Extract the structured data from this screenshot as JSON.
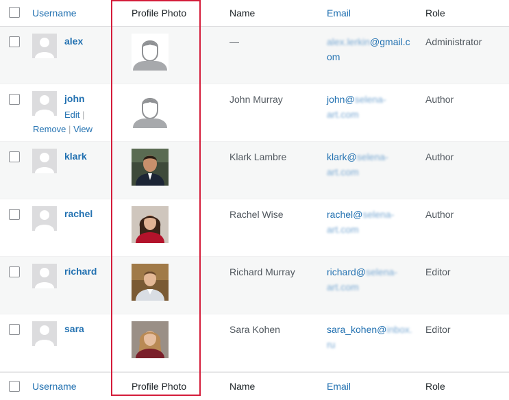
{
  "columns": {
    "username": "Username",
    "profile_photo": "Profile Photo",
    "name": "Name",
    "email": "Email",
    "role": "Role"
  },
  "row_actions": {
    "edit": "Edit",
    "remove": "Remove",
    "view": "View",
    "separator": "|"
  },
  "users": [
    {
      "username": "alex",
      "name": "—",
      "email_visible": "@gmail.c",
      "email_blurred_1": "alex.lerkin",
      "email_line2": "om",
      "email_line2_blurred": "",
      "role": "Administrator",
      "photo": "placeholder"
    },
    {
      "username": "john",
      "name": "John Murray",
      "email_visible": "john@",
      "email_blurred_1": "selena-",
      "email_line2": "",
      "email_line2_blurred": "art.com",
      "role": "Author",
      "photo": "placeholder"
    },
    {
      "username": "klark",
      "name": "Klark Lambre",
      "email_visible": "klark@",
      "email_blurred_1": "selena-",
      "email_line2": "",
      "email_line2_blurred": "art.com",
      "role": "Author",
      "photo": "man-dark"
    },
    {
      "username": "rachel",
      "name": "Rachel Wise",
      "email_visible": "rachel@",
      "email_blurred_1": "selena-",
      "email_line2": "",
      "email_line2_blurred": "art.com",
      "role": "Author",
      "photo": "woman-red"
    },
    {
      "username": "richard",
      "name": "Richard Murray",
      "email_visible": "richard@",
      "email_blurred_1": "selena-",
      "email_line2": "",
      "email_line2_blurred": "art.com",
      "role": "Editor",
      "photo": "man-light"
    },
    {
      "username": "sara",
      "name": "Sara Kohen",
      "email_visible": "sara_kohen@",
      "email_blurred_1": "inbox.",
      "email_line2": "",
      "email_line2_blurred": "ru",
      "role": "Editor",
      "photo": "woman-blonde"
    }
  ],
  "colors": {
    "link": "#2271b1",
    "highlight": "#d41c3a",
    "stripe": "#f6f7f7"
  }
}
